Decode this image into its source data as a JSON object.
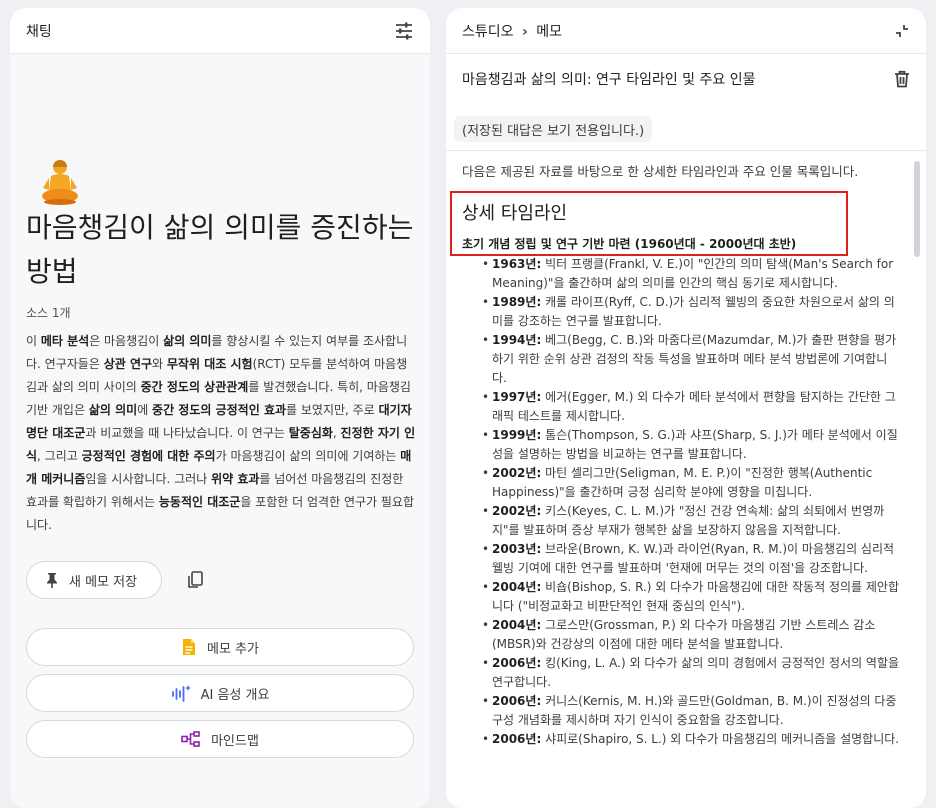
{
  "left": {
    "header_title": "채팅",
    "title": "마음챙김이 삶의 의미를 증진하는 방법",
    "source_count": "소스 1개",
    "summary": [
      {
        "t": "이 ",
        "b": false
      },
      {
        "t": "메타 분석",
        "b": true
      },
      {
        "t": "은 마음챙김이 ",
        "b": false
      },
      {
        "t": "삶의 의미",
        "b": true
      },
      {
        "t": "를 향상시킬 수 있는지 여부를 조사합니다. 연구자들은 ",
        "b": false
      },
      {
        "t": "상관 연구",
        "b": true
      },
      {
        "t": "와 ",
        "b": false
      },
      {
        "t": "무작위 대조 시험",
        "b": true
      },
      {
        "t": "(RCT) 모두를 분석하여 마음챙김과 삶의 의미 사이의 ",
        "b": false
      },
      {
        "t": "중간 정도의 상관관계",
        "b": true
      },
      {
        "t": "를 발견했습니다. 특히, 마음챙김 기반 개입은 ",
        "b": false
      },
      {
        "t": "삶의 의미",
        "b": true
      },
      {
        "t": "에 ",
        "b": false
      },
      {
        "t": "중간 정도의 긍정적인 효과",
        "b": true
      },
      {
        "t": "를 보였지만, 주로 ",
        "b": false
      },
      {
        "t": "대기자 명단 대조군",
        "b": true
      },
      {
        "t": "과 비교했을 때 나타났습니다. 이 연구는 ",
        "b": false
      },
      {
        "t": "탈중심화",
        "b": true
      },
      {
        "t": ", ",
        "b": false
      },
      {
        "t": "진정한 자기 인식",
        "b": true
      },
      {
        "t": ", 그리고 ",
        "b": false
      },
      {
        "t": "긍정적인 경험에 대한 주의",
        "b": true
      },
      {
        "t": "가 마음챙김이 삶의 의미에 기여하는 ",
        "b": false
      },
      {
        "t": "매개 메커니즘",
        "b": true
      },
      {
        "t": "임을 시사합니다. 그러나 ",
        "b": false
      },
      {
        "t": "위약 효과",
        "b": true
      },
      {
        "t": "를 넘어선 마음챙김의 진정한 효과를 확립하기 위해서는 ",
        "b": false
      },
      {
        "t": "능동적인 대조군",
        "b": true
      },
      {
        "t": "을 포함한 더 엄격한 연구가 필요합니다.",
        "b": false
      }
    ],
    "save_note_label": "새 메모 저장",
    "add_note_label": "메모 추가",
    "audio_overview_label": "AI 음성 개요",
    "mindmap_label": "마인드맵",
    "icons": {
      "tune": "tune-icon",
      "pin": "pin-icon",
      "copy": "copy-icon",
      "note": "note-icon",
      "audio": "audio-sparkle-icon",
      "mindmap": "mindmap-icon",
      "meditation": "meditation-emoji-icon"
    },
    "colors": {
      "note_icon": "#f4b400",
      "audio_icon": "#4a6cf7",
      "mindmap_icon": "#8e24aa"
    }
  },
  "right": {
    "breadcrumb_studio": "스튜디오",
    "breadcrumb_sep": ">",
    "breadcrumb_memo": "메모",
    "memo_title": "마음챙김과 삶의 의미: 연구 타임라인 및 주요 인물",
    "readonly_notice": "(저장된 대답은 보기 전용입니다.)",
    "intro": "다음은 제공된 자료를 바탕으로 한 상세한 타임라인과 주요 인물 목록입니다.",
    "section_title": "상세 타임라인",
    "subsection_title": "초기 개념 정립 및 연구 기반 마련 (1960년대 - 2000년대 초반)",
    "highlight_color": "#e0201c",
    "timeline": [
      {
        "year": "1963년:",
        "text": " 빅터 프랭클(Frankl, V. E.)이 \"인간의 의미 탐색(Man's Search for Meaning)\"을 출간하며 삶의 의미를 인간의 핵심 동기로 제시합니다."
      },
      {
        "year": "1989년:",
        "text": " 캐롤 라이프(Ryff, C. D.)가 심리적 웰빙의 중요한 차원으로서 삶의 의미를 강조하는 연구를 발표합니다."
      },
      {
        "year": "1994년:",
        "text": " 베그(Begg, C. B.)와 마줌다르(Mazumdar, M.)가 출판 편향을 평가하기 위한 순위 상관 검정의 작동 특성을 발표하며 메타 분석 방법론에 기여합니다."
      },
      {
        "year": "1997년:",
        "text": " 에거(Egger, M.) 외 다수가 메타 분석에서 편향을 탐지하는 간단한 그래픽 테스트를 제시합니다."
      },
      {
        "year": "1999년:",
        "text": " 톰슨(Thompson, S. G.)과 샤프(Sharp, S. J.)가 메타 분석에서 이질성을 설명하는 방법을 비교하는 연구를 발표합니다."
      },
      {
        "year": "2002년:",
        "text": " 마틴 셀리그만(Seligman, M. E. P.)이 \"진정한 행복(Authentic Happiness)\"을 출간하며 긍정 심리학 분야에 영향을 미칩니다."
      },
      {
        "year": "2002년:",
        "text": " 키스(Keyes, C. L. M.)가 \"정신 건강 연속체: 삶의 쇠퇴에서 번영까지\"를 발표하며 증상 부재가 행복한 삶을 보장하지 않음을 지적합니다."
      },
      {
        "year": "2003년:",
        "text": " 브라운(Brown, K. W.)과 라이언(Ryan, R. M.)이 마음챙김의 심리적 웰빙 기여에 대한 연구를 발표하며 '현재에 머무는 것의 이점'을 강조합니다."
      },
      {
        "year": "2004년:",
        "text": " 비숍(Bishop, S. R.) 외 다수가 마음챙김에 대한 작동적 정의를 제안합니다 (\"비정교화고 비판단적인 현재 중심의 인식\")."
      },
      {
        "year": "2004년:",
        "text": " 그로스만(Grossman, P.) 외 다수가 마음챙김 기반 스트레스 감소(MBSR)와 건강상의 이점에 대한 메타 분석을 발표합니다."
      },
      {
        "year": "2006년:",
        "text": " 킹(King, L. A.) 외 다수가 삶의 의미 경험에서 긍정적인 정서의 역할을 연구합니다."
      },
      {
        "year": "2006년:",
        "text": " 커니스(Kernis, M. H.)와 골드만(Goldman, B. M.)이 진정성의 다중 구성 개념화를 제시하며 자기 인식이 중요함을 강조합니다."
      },
      {
        "year": "2006년:",
        "text": " 샤피로(Shapiro, S. L.) 외 다수가 마음챙김의 메커니즘을 설명합니다."
      }
    ],
    "icons": {
      "collapse": "collapse-icon",
      "delete": "trash-icon",
      "chevron": "chevron-right-icon"
    }
  }
}
